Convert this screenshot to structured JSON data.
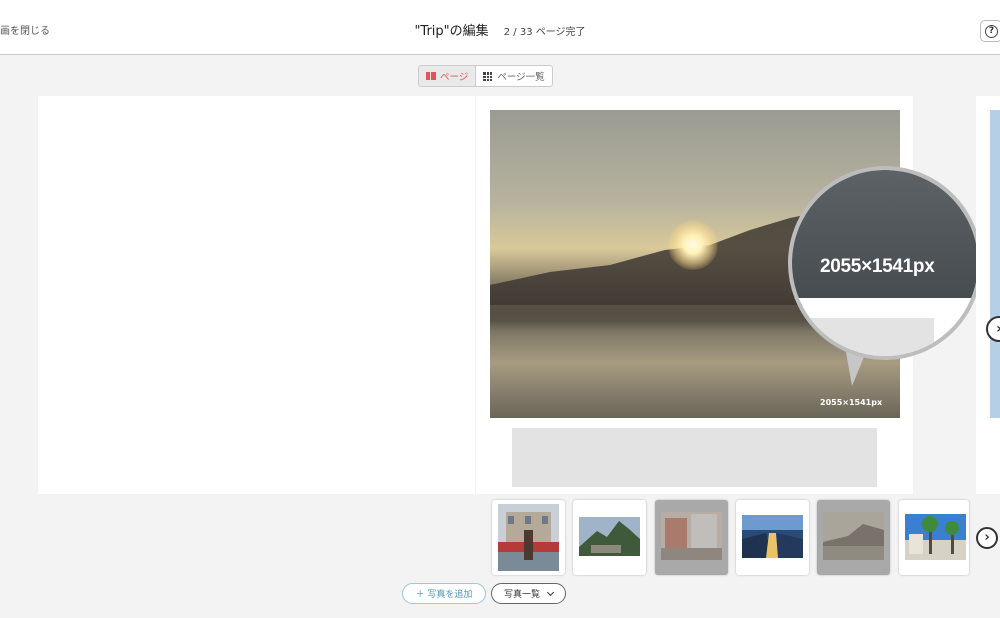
{
  "header": {
    "close_label": "画を閉じる",
    "title": "\"Trip\"の編集",
    "progress": "2 / 33 ページ完了",
    "help_icon": "?"
  },
  "view_toggle": {
    "page_label": "ページ",
    "list_label": "ページ一覧",
    "active": "page"
  },
  "spread": {
    "photo_resolution": "2055×1541px",
    "zoom_label": "2055×1541px"
  },
  "nav": {
    "next_page_icon": "chevron-right-icon",
    "next_page_glyph": "›",
    "thumbs_next_glyph": "›"
  },
  "thumbnails": [
    {
      "name": "street-market",
      "used": false
    },
    {
      "name": "mountain-ruins",
      "used": false
    },
    {
      "name": "city-buildings",
      "used": true
    },
    {
      "name": "harbor-night",
      "used": false
    },
    {
      "name": "sunset-lake",
      "used": true
    },
    {
      "name": "palm-city",
      "used": false
    }
  ],
  "buttons": {
    "add_photo": "＋ 写真を追加",
    "photo_list": "写真一覧"
  },
  "colors": {
    "accent": "#e0555b",
    "add_button": "#4a9ab5"
  }
}
